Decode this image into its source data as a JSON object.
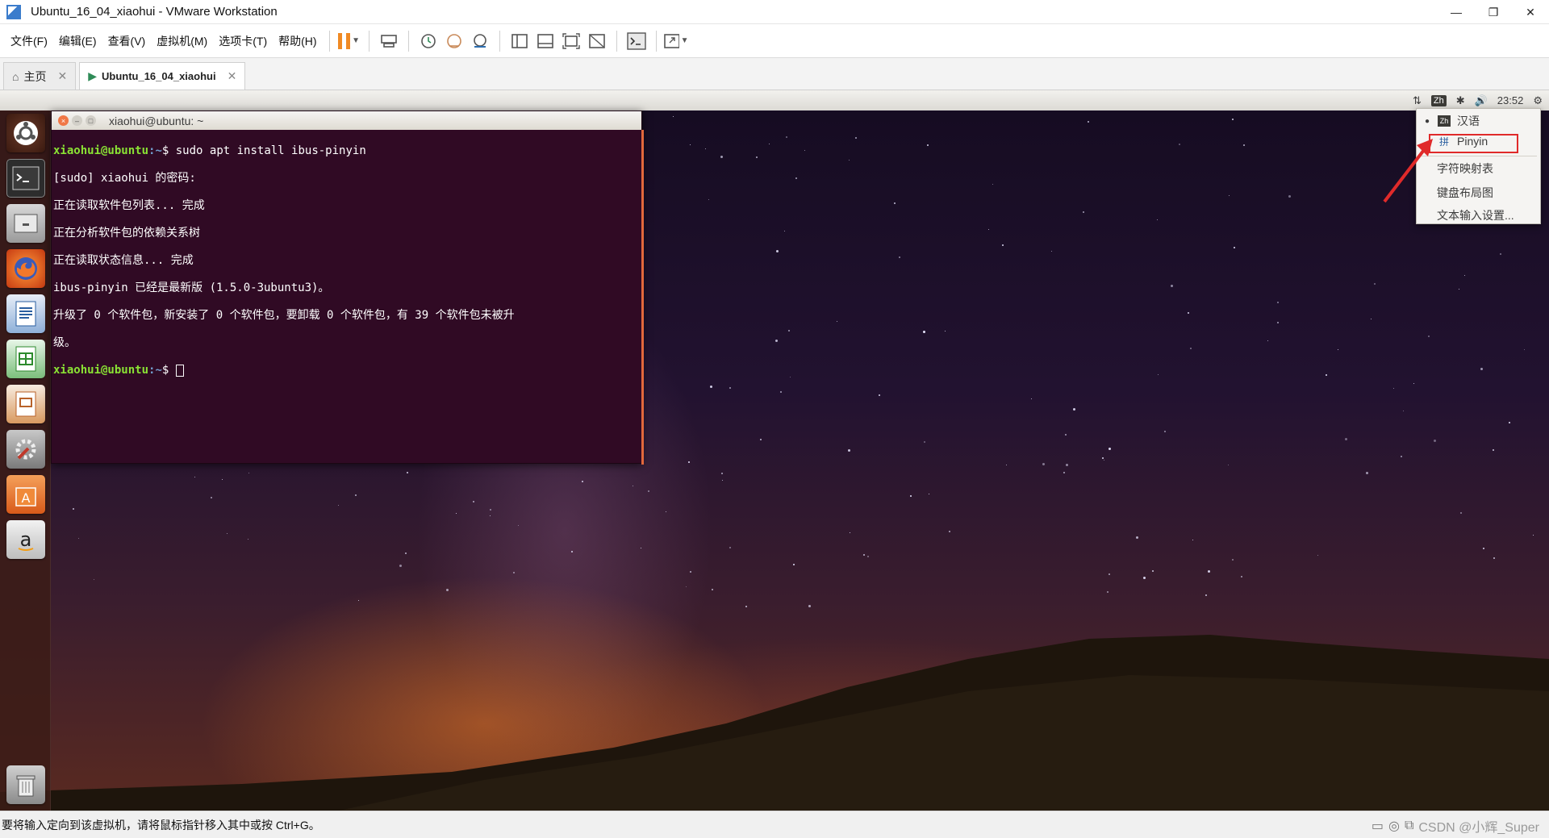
{
  "window": {
    "title": "Ubuntu_16_04_xiaohui - VMware Workstation",
    "controls": [
      "—",
      "❐",
      "✕"
    ]
  },
  "menu": {
    "items": [
      "文件(F)",
      "编辑(E)",
      "查看(V)",
      "虚拟机(M)",
      "选项卡(T)",
      "帮助(H)"
    ]
  },
  "tabs": {
    "home": "主页",
    "vm": "Ubuntu_16_04_xiaohui"
  },
  "ubuntu_panel": {
    "ime_indicator": "Zh",
    "time": "23:52"
  },
  "terminal": {
    "title": "xiaohui@ubuntu: ~",
    "prompt_user": "xiaohui@ubuntu",
    "prompt_path": ":~",
    "prompt_symbol": "$",
    "command": " sudo apt install ibus-pinyin",
    "lines": [
      "[sudo] xiaohui 的密码:",
      "正在读取软件包列表... 完成",
      "正在分析软件包的依赖关系树",
      "正在读取状态信息... 完成",
      "ibus-pinyin 已经是最新版 (1.5.0-3ubuntu3)。",
      "升级了 0 个软件包，新安装了 0 个软件包，要卸载 0 个软件包，有 39 个软件包未被升",
      "级。"
    ]
  },
  "ime_menu": {
    "items": [
      {
        "label": "汉语",
        "icon": "Zh",
        "selected": true
      },
      {
        "label": "Pinyin",
        "icon": "拼",
        "selected": false
      },
      {
        "label": "字符映射表"
      },
      {
        "label": "键盘布局图"
      },
      {
        "label": "文本输入设置..."
      }
    ]
  },
  "statusbar": {
    "message": "要将输入定向到该虚拟机，请将鼠标指针移入其中或按 Ctrl+G。",
    "watermark": "CSDN @小辉_Super"
  },
  "colors": {
    "terminal_bg": "#300a24",
    "prompt_green": "#8ae234",
    "accent_orange": "#f08a24",
    "highlight_red": "#e02a2a"
  }
}
